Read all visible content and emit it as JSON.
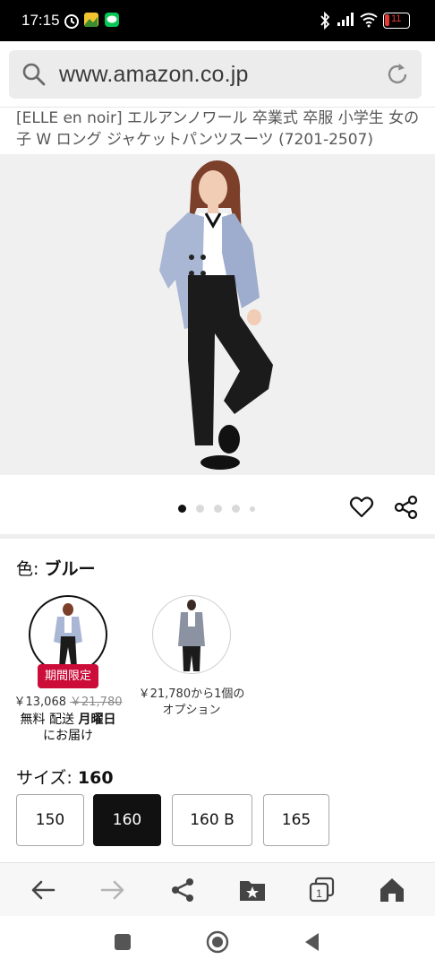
{
  "status_bar": {
    "time": "17:15",
    "battery": "11"
  },
  "browser": {
    "url": "www.amazon.co.jp"
  },
  "product": {
    "title": "[ELLE en noir] エルアンノワール 卒業式 卒服 小学生 女の子 W ロング ジャケットパンツスーツ (7201-2507)"
  },
  "color": {
    "label": "色:",
    "selected": "ブルー",
    "options": [
      {
        "badge": "期間限定",
        "price": "￥13,068",
        "list_price": "￥21,780",
        "delivery_prefix": "無料 配送",
        "delivery_day": "月曜日",
        "delivery_suffix": "にお届け"
      },
      {
        "offer_line1": "￥21,780から1個の",
        "offer_line2": "オプション"
      }
    ]
  },
  "size": {
    "label": "サイズ:",
    "selected": "160",
    "options": [
      "150",
      "160",
      "160 B",
      "165"
    ]
  },
  "colors": {
    "accent_badge": "#cc0c39",
    "selected_button": "#111111"
  }
}
